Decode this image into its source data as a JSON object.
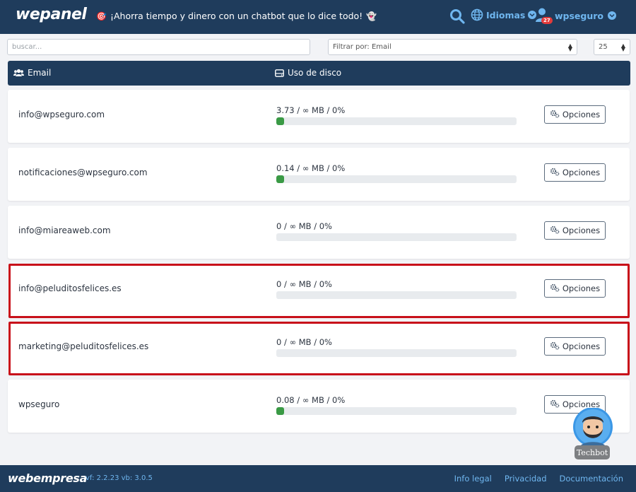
{
  "header": {
    "logo": "wepanel",
    "promo_text": "¡Ahorra tiempo y dinero con un chatbot que lo dice todo!",
    "promo_emoji_left": "🎯",
    "promo_emoji_right": "👻",
    "language_label": "Idiomas",
    "user_label": "wpseguro",
    "notification_count": "27"
  },
  "filters": {
    "search_placeholder": "buscar...",
    "filter_value": "Filtrar por: Email",
    "page_size": "25"
  },
  "table": {
    "col_email": "Email",
    "col_disk": "Uso de disco",
    "options_label": "Opciones",
    "rows": [
      {
        "email": "info@wpseguro.com",
        "usage": "3.73 / ∞ MB / 0%",
        "fill": 0.03
      },
      {
        "email": "notificaciones@wpseguro.com",
        "usage": "0.14 / ∞ MB / 0%",
        "fill": 0.03
      },
      {
        "email": "info@miareaweb.com",
        "usage": "0 / ∞ MB / 0%",
        "fill": 0
      },
      {
        "email": "info@peluditosfelices.es",
        "usage": "0 / ∞ MB / 0%",
        "fill": 0,
        "highlighted": true
      },
      {
        "email": "marketing@peluditosfelices.es",
        "usage": "0 / ∞ MB / 0%",
        "fill": 0,
        "highlighted": true
      },
      {
        "email": "wpseguro",
        "usage": "0.08 / ∞ MB / 0%",
        "fill": 0.03
      }
    ]
  },
  "chatbot": {
    "label": "Techbot"
  },
  "footer": {
    "logo": "webempresa",
    "version": "vf: 2.2.23 vb: 3.0.5",
    "links": [
      "Info legal",
      "Privacidad",
      "Documentación"
    ]
  },
  "colors": {
    "navy": "#1f3c5c",
    "accent_blue": "#6fb6ef",
    "bar_green": "#3a9a45",
    "highlight_red": "#c8101a"
  }
}
